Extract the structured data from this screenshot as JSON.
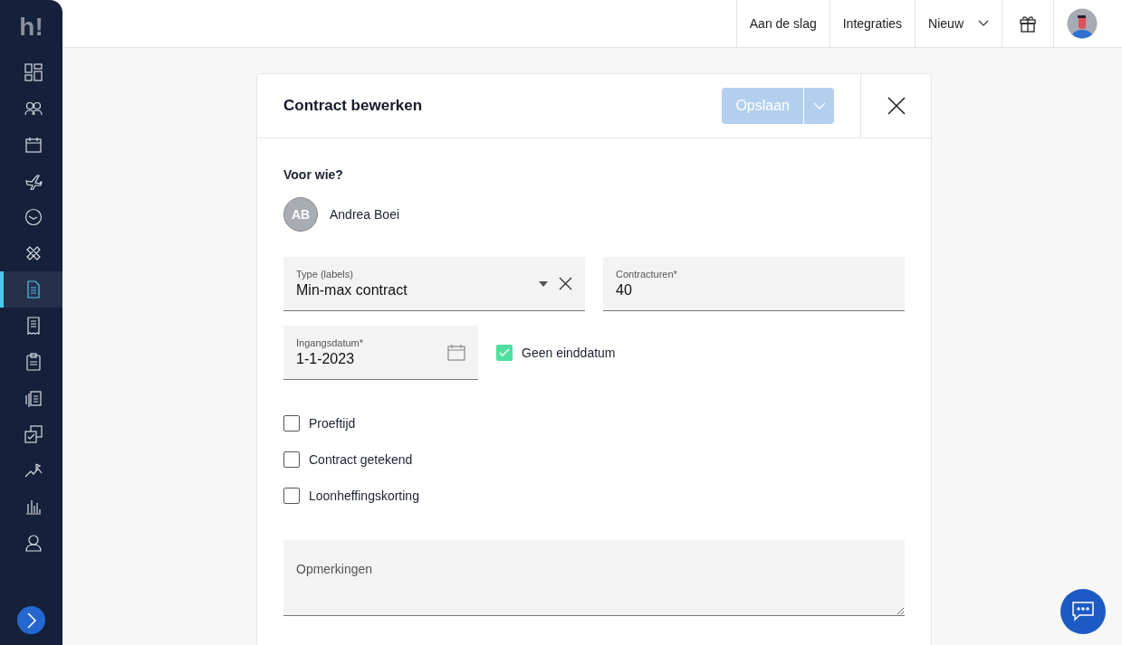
{
  "sidebar": {
    "logo": "h!",
    "items": [
      {
        "kind": "dashboard",
        "selected": false
      },
      {
        "kind": "people",
        "selected": false
      },
      {
        "kind": "calendar",
        "selected": false
      },
      {
        "kind": "plane",
        "selected": false
      },
      {
        "kind": "clock",
        "selected": false
      },
      {
        "kind": "bandage",
        "selected": false
      },
      {
        "kind": "document",
        "selected": true
      },
      {
        "kind": "receipt",
        "selected": false
      },
      {
        "kind": "clipboard",
        "selected": false
      },
      {
        "kind": "stack",
        "selected": false
      },
      {
        "kind": "check",
        "selected": false
      },
      {
        "kind": "trend",
        "selected": false
      },
      {
        "kind": "bars",
        "selected": false
      },
      {
        "kind": "user",
        "selected": false
      }
    ]
  },
  "topbar": {
    "links": [
      "Aan de slag",
      "Integraties"
    ],
    "dropdown": "Nieuw"
  },
  "dialog": {
    "title": "Contract bewerken",
    "save_button": "Opslaan",
    "save_disabled": true,
    "for_label": "Voor wie?",
    "person": {
      "initials": "AB",
      "name": "Andrea Boei"
    },
    "type_field": {
      "label": "Type (labels)",
      "value": "Min-max contract"
    },
    "hours_field": {
      "label": "Contracturen*",
      "value": "40"
    },
    "start_field": {
      "label": "Ingangsdatum*",
      "value": "1-1-2023"
    },
    "no_end_date": {
      "label": "Geen einddatum",
      "checked": true
    },
    "checkboxes": [
      {
        "label": "Proeftijd",
        "checked": false
      },
      {
        "label": "Contract getekend",
        "checked": false
      },
      {
        "label": "Loonheffingskorting",
        "checked": false
      }
    ],
    "remarks": {
      "placeholder": "Opmerkingen"
    }
  }
}
